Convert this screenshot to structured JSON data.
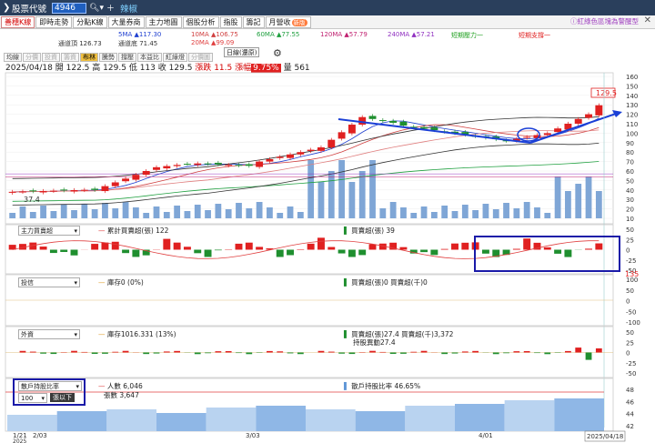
{
  "titlebar": {
    "title": "股票代號",
    "symbol": "4946",
    "stock_name": "辣椒",
    "icons": [
      "search-icon",
      "add-icon"
    ]
  },
  "tabs": [
    {
      "label": "善穗K線",
      "active": true
    },
    {
      "label": "即時走勢"
    },
    {
      "label": "分點K線"
    },
    {
      "label": "大量券商"
    },
    {
      "label": "主力地圖"
    },
    {
      "label": "個股分析"
    },
    {
      "label": "指股"
    },
    {
      "label": "籌記"
    },
    {
      "label": "月營收",
      "badge": "新版"
    }
  ],
  "right_info": "ⓘ紅綠色區塊為警醒型",
  "ma_legend": {
    "ma5": "5MA ▲117.30",
    "ma10": "10MA ▲106.75",
    "ma60": "60MA ▲77.55",
    "ma120": "120MA ▲57.79",
    "ma240": "240MA ▲57.21",
    "short_pressure": "短期壓力一",
    "short_support": "短期支撐一",
    "channel_top": "通道頂 126.73",
    "channel_bottom": "通道底 71.45",
    "ma20": "20MA ▲99.09"
  },
  "colors": {
    "up": "#e02020",
    "down": "#1f8f2f",
    "volume": "#7fa6d6",
    "highlight_box": "#1a1aa8",
    "arrow": "#1a3fd6"
  },
  "quote": {
    "date": "2025/04/18",
    "open_label": "開",
    "open": "122.5",
    "high_label": "高",
    "high": "129.5",
    "low_label": "低",
    "low": "113",
    "close_label": "收",
    "close": "129.5",
    "change_label": "漲跌",
    "change": "11.5",
    "pct_label": "漲幅",
    "pct": "9.75%",
    "vol_label": "量",
    "volume": "561",
    "period": "日線(還原)"
  },
  "subtabs": [
    "均線",
    "分價",
    "投資",
    "籌資",
    "布林",
    "騰勢",
    "撐壓",
    "本益比",
    "紅綠燈",
    "分價圖"
  ],
  "price_panel": {
    "y_ticks": [
      "160",
      "150",
      "140",
      "130",
      "120",
      "110",
      "100",
      "90",
      "80",
      "70",
      "60",
      "50",
      "40",
      "30",
      "20",
      "10"
    ],
    "last_price_tag": "129.5",
    "low_tag": "37.4"
  },
  "main_force_panel": {
    "selector": "主力買賣超",
    "label_cum": "累計買賣超(張) 122",
    "label_daily": "買賣超(張) 39",
    "y_ticks": [
      "50",
      "25",
      "0",
      "-25",
      "-50"
    ],
    "side_value": "135"
  },
  "investment_panel": {
    "selector": "投信",
    "label_hold": "庫存0 (0%)",
    "label_daily": "買賣超(張)0 買賣超(千)0",
    "y_ticks": [
      "100",
      "50",
      "0",
      "-50",
      "-100"
    ]
  },
  "foreign_panel": {
    "selector": "外資",
    "label_hold": "庫存1016.331 (13%)",
    "label_daily": "買賣超(張)27.4 買賣超(千)3,372",
    "label_avg": "持股異動27.4",
    "y_ticks": [
      "50",
      "25",
      "0",
      "-25",
      "-50"
    ]
  },
  "holders_panel": {
    "selector": "散戶持股比率",
    "count_select": "100",
    "btn_label": "張以下",
    "label_people": "人數 6,046",
    "label_shares": "張數 3,647",
    "label_ratio": "散戶持股比率 46.65%",
    "y_ticks": [
      "48",
      "46",
      "44",
      "42"
    ]
  },
  "x_axis": {
    "labels": [
      "1/21",
      "2/03",
      "3/03",
      "4/01",
      "2025/04/18"
    ],
    "year_label": "2025"
  }
}
